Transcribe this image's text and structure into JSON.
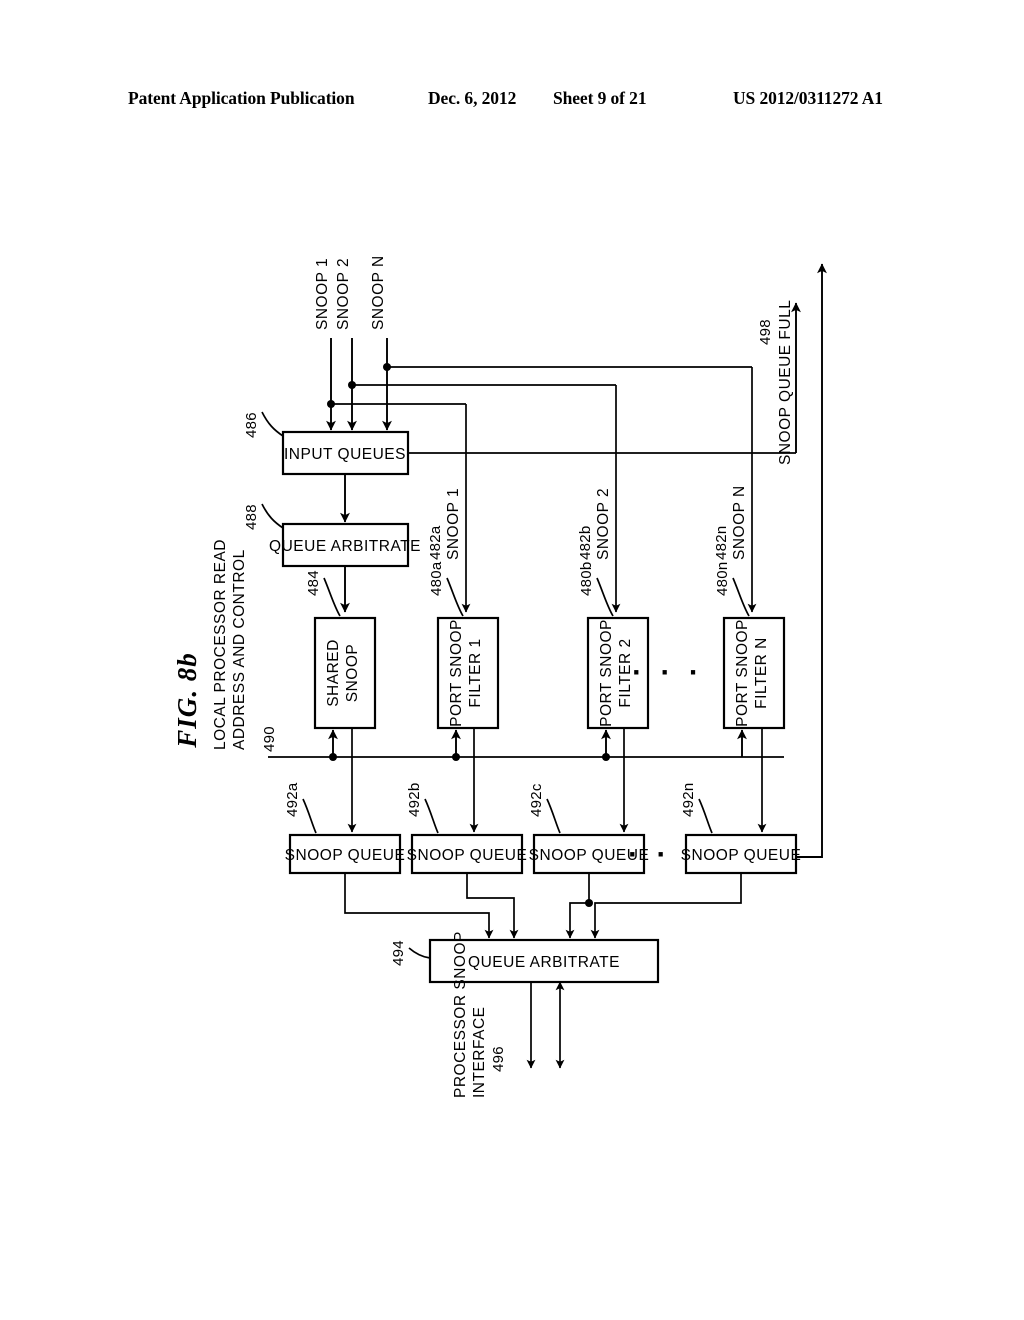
{
  "header": {
    "publication": "Patent Application Publication",
    "date": "Dec. 6, 2012",
    "sheet": "Sheet 9 of 21",
    "number": "US 2012/0311272 A1"
  },
  "figure": {
    "label": "FIG. 8b"
  },
  "inputs": [
    {
      "name": "snoop-1",
      "label": "SNOOP 1"
    },
    {
      "name": "snoop-2",
      "label": "SNOOP 2"
    },
    {
      "name": "snoop-n",
      "label": "SNOOP N"
    }
  ],
  "blocks": {
    "input_queues": {
      "label": "INPUT QUEUES",
      "ref": "486"
    },
    "queue_arbitrate_top": {
      "label": "QUEUE ARBITRATE",
      "ref": "488"
    },
    "shared_snoop": {
      "line1": "SHARED",
      "line2": "SNOOP",
      "ref": "484"
    },
    "port_snoop_filter_1": {
      "line1": "PORT SNOOP",
      "line2": "FILTER 1",
      "ref": "480a"
    },
    "port_snoop_filter_2": {
      "line1": "PORT SNOOP",
      "line2": "FILTER 2",
      "ref": "480b"
    },
    "port_snoop_filter_n": {
      "line1": "PORT SNOOP",
      "line2": "FILTER N",
      "ref": "480n"
    },
    "snoop_queue_a": {
      "label": "SNOOP QUEUE",
      "ref": "492a"
    },
    "snoop_queue_b": {
      "label": "SNOOP QUEUE",
      "ref": "492b"
    },
    "snoop_queue_c": {
      "label": "SNOOP QUEUE",
      "ref": "492c"
    },
    "snoop_queue_n": {
      "label": "SNOOP QUEUE",
      "ref": "492n"
    },
    "queue_arbitrate_bottom": {
      "label": "QUEUE ARBITRATE",
      "ref": "494"
    }
  },
  "signals": {
    "snoop_1_tap": {
      "label": "SNOOP 1",
      "ref": "482a"
    },
    "snoop_2_tap": {
      "label": "SNOOP 2",
      "ref": "482b"
    },
    "snoop_n_tap": {
      "label": "SNOOP N",
      "ref": "482n"
    },
    "local_bus": {
      "line1": "LOCAL PROCESSOR READ",
      "line2": "ADDRESS AND CONTROL",
      "ref": "490"
    },
    "snoop_queue_full": {
      "label": "SNOOP QUEUE FULL",
      "ref": "498"
    },
    "processor_snoop_interface": {
      "line1": "PROCESSOR SNOOP",
      "line2": "INTERFACE",
      "ref": "496"
    }
  },
  "ellipsis": "· · ·"
}
